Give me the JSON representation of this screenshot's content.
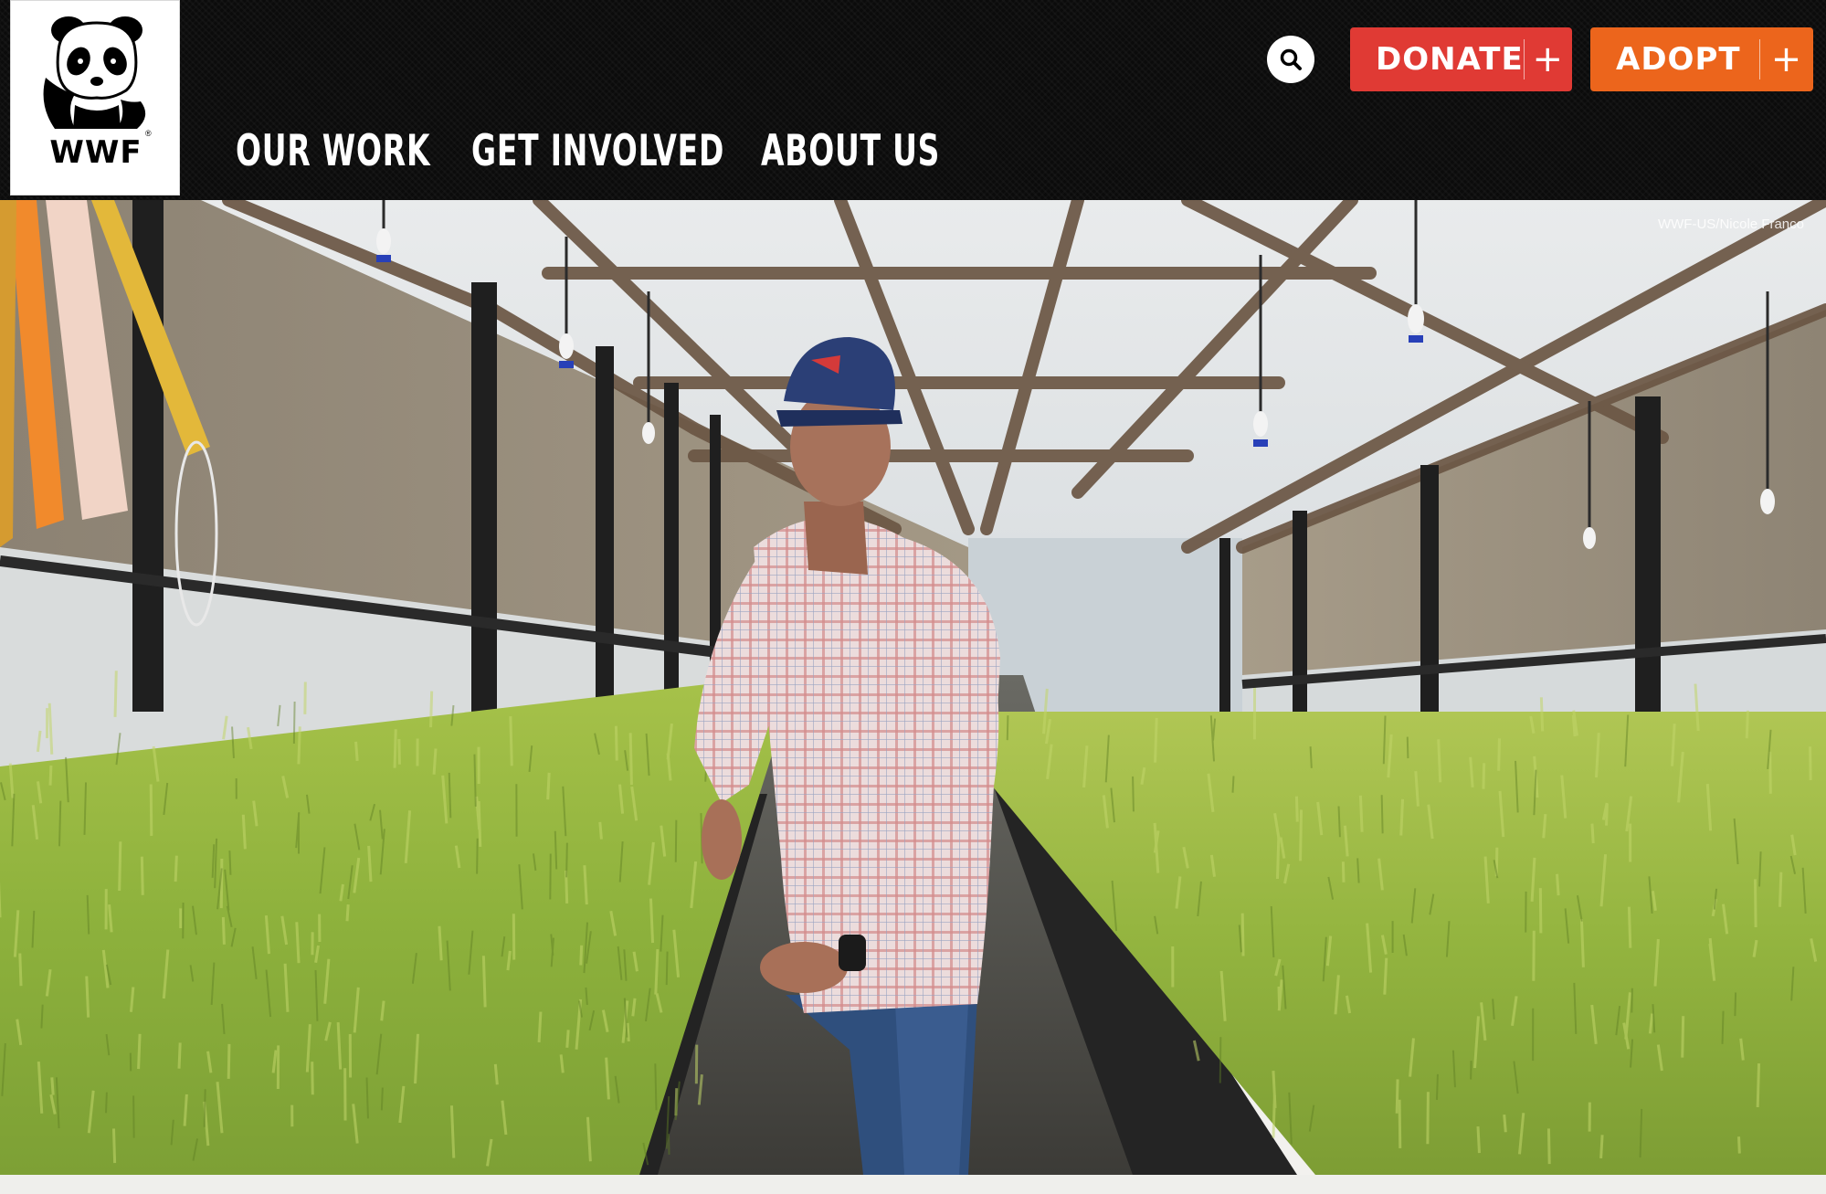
{
  "brand": {
    "logo_text": "WWF",
    "logo_alt": "WWF panda logo"
  },
  "nav": {
    "items": [
      {
        "label": "OUR WORK"
      },
      {
        "label": "GET INVOLVED"
      },
      {
        "label": "ABOUT US"
      }
    ]
  },
  "header": {
    "search_icon": "search-icon",
    "donate_label": "DONATE",
    "donate_icon": "+",
    "adopt_label": "ADOPT",
    "adopt_icon": "+"
  },
  "hero": {
    "photo_credit": "WWF-US/Nicole Franco"
  },
  "colors": {
    "header_bg": "#0b0b0b",
    "donate": "#e03a34",
    "adopt": "#ec651c"
  }
}
